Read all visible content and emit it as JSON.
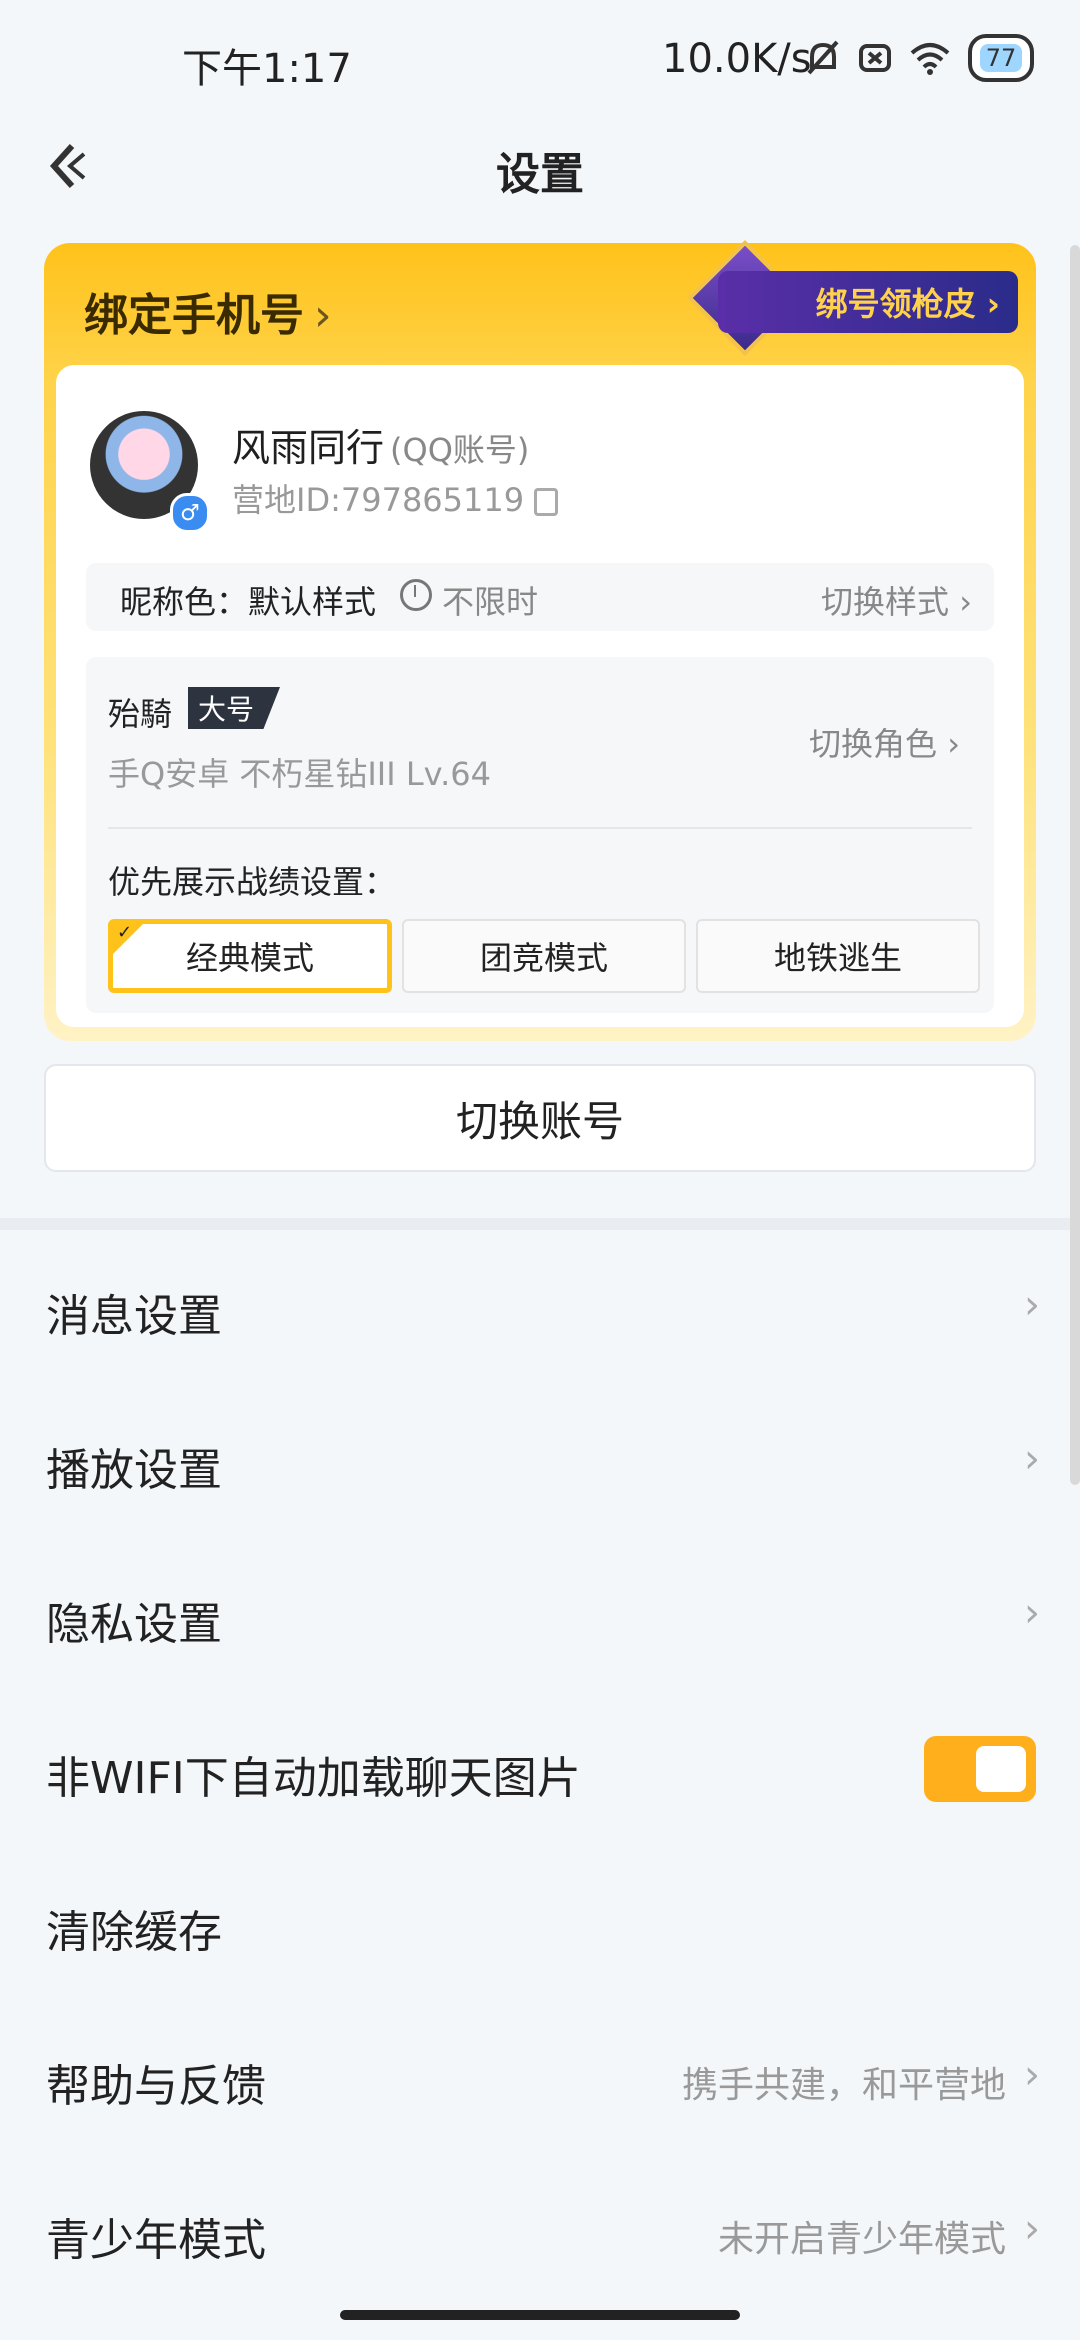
{
  "status_bar": {
    "time": "下午1:17",
    "net_speed": "10.0K/s",
    "battery": "77",
    "icons": [
      "bell-off-icon",
      "x-box-icon",
      "wifi-icon",
      "battery-icon"
    ]
  },
  "header": {
    "title": "设置",
    "back_icon": "back-arrow-icon"
  },
  "account_card": {
    "bind_phone": "绑定手机号",
    "chevron": "›",
    "promo": "绑号领枪皮 ›",
    "user": {
      "name": "风雨同行",
      "account_type": "(QQ账号)",
      "id_line": "营地ID:797865119",
      "gender": "♂"
    },
    "nick_color": {
      "label": "昵称色：默认样式",
      "unlimited": "不限时",
      "switch_style": "切换样式 ›"
    },
    "role": {
      "name": "殆騎",
      "tag": "大号",
      "desc": "手Q安卓  不朽星钻III  Lv.64",
      "switch_role": "切换角色 ›",
      "pref_label": "优先展示战绩设置：",
      "modes": [
        "经典模式",
        "团竞模式",
        "地铁逃生"
      ],
      "active_mode": "经典模式"
    }
  },
  "switch_account": "切换账号",
  "menu": {
    "items": [
      {
        "label": "消息设置",
        "value": "",
        "arrow": "›"
      },
      {
        "label": "播放设置",
        "value": "",
        "arrow": "›"
      },
      {
        "label": "隐私设置",
        "value": "",
        "arrow": "›"
      },
      {
        "label": "非WIFI下自动加载聊天图片",
        "value": "",
        "toggle": "on"
      },
      {
        "label": "清除缓存",
        "value": "",
        "arrow": ""
      },
      {
        "label": "帮助与反馈",
        "value": "携手共建，和平营地",
        "arrow": "›"
      },
      {
        "label": "青少年模式",
        "value": "未开启青少年模式",
        "arrow": "›"
      }
    ]
  },
  "colors": {
    "accent": "#ffc21a",
    "toggle_on": "#ffae1c",
    "promo_bg": "#4b2ea0"
  }
}
